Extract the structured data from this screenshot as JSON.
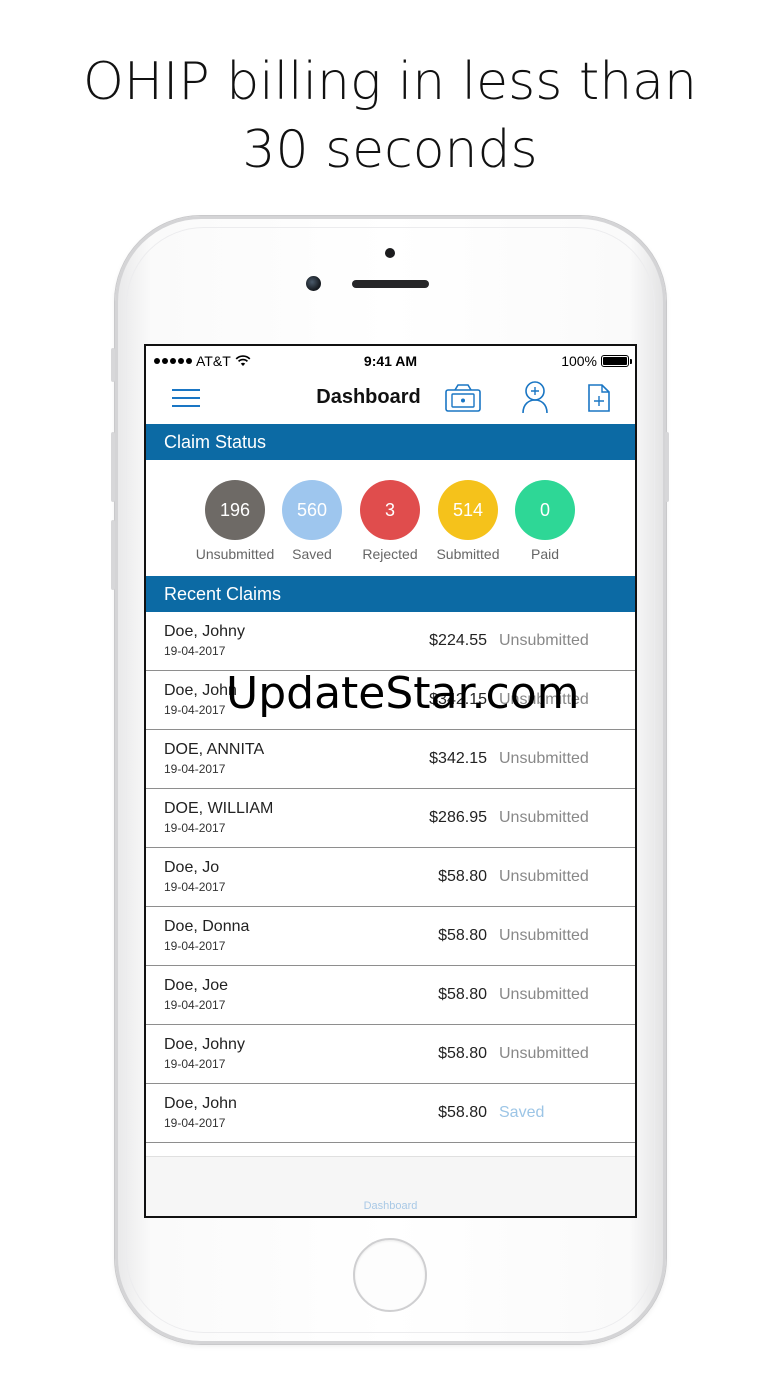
{
  "headline": {
    "line1": "OHIP billing in less than",
    "line2": "30 seconds"
  },
  "status_bar": {
    "carrier": "AT&T",
    "time": "9:41 AM",
    "battery": "100%"
  },
  "nav": {
    "title": "Dashboard",
    "icons": [
      "menu-icon",
      "camera-icon",
      "add-patient-icon",
      "new-claim-icon"
    ]
  },
  "claim_status": {
    "header": "Claim Status",
    "items": [
      {
        "count": "196",
        "label": "Unsubmitted",
        "color": "#6e6a66"
      },
      {
        "count": "560",
        "label": "Saved",
        "color": "#9ec6ee"
      },
      {
        "count": "3",
        "label": "Rejected",
        "color": "#e04d4d"
      },
      {
        "count": "514",
        "label": "Submitted",
        "color": "#f5c21b"
      },
      {
        "count": "0",
        "label": "Paid",
        "color": "#2ed796"
      }
    ]
  },
  "recent_claims": {
    "header": "Recent Claims",
    "rows": [
      {
        "name": "Doe, Johny",
        "date": "19-04-2017",
        "amount": "$224.55",
        "status": "Unsubmitted"
      },
      {
        "name": "Doe, John",
        "date": "19-04-2017",
        "amount": "$342.15",
        "status": "Unsubmitted"
      },
      {
        "name": "DOE, ANNITA",
        "date": "19-04-2017",
        "amount": "$342.15",
        "status": "Unsubmitted"
      },
      {
        "name": "DOE, WILLIAM",
        "date": "19-04-2017",
        "amount": "$286.95",
        "status": "Unsubmitted"
      },
      {
        "name": "Doe, Jo",
        "date": "19-04-2017",
        "amount": "$58.80",
        "status": "Unsubmitted"
      },
      {
        "name": "Doe, Donna",
        "date": "19-04-2017",
        "amount": "$58.80",
        "status": "Unsubmitted"
      },
      {
        "name": "Doe, Joe",
        "date": "19-04-2017",
        "amount": "$58.80",
        "status": "Unsubmitted"
      },
      {
        "name": "Doe, Johny",
        "date": "19-04-2017",
        "amount": "$58.80",
        "status": "Unsubmitted"
      },
      {
        "name": "Doe, John",
        "date": "19-04-2017",
        "amount": "$58.80",
        "status": "Saved"
      }
    ]
  },
  "tabbar": {
    "label": "Dashboard"
  },
  "watermark": "UpdateStar.com"
}
